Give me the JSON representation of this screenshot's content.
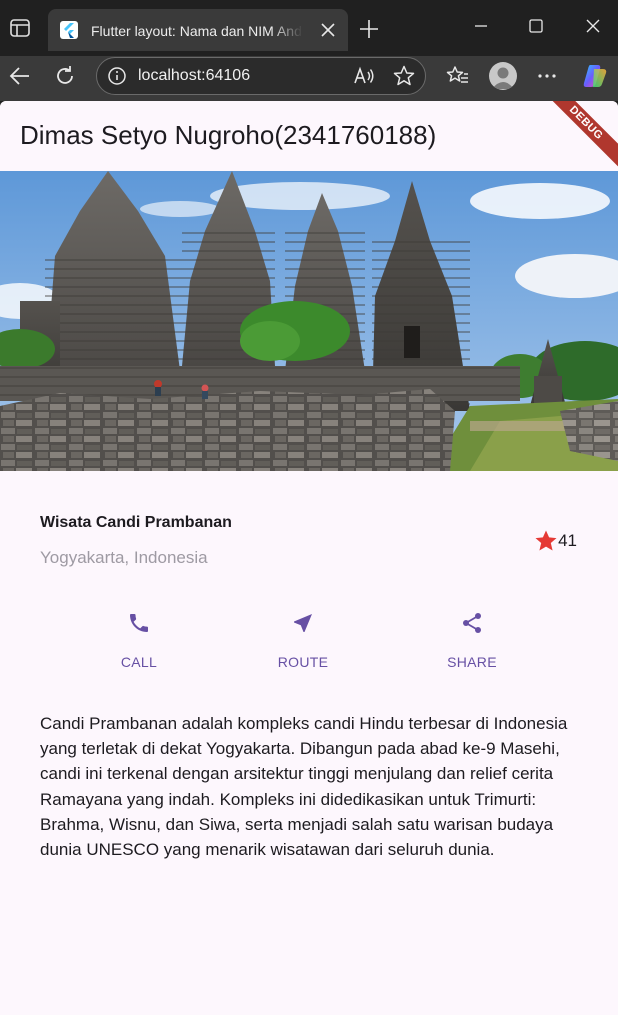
{
  "browser": {
    "tab_title": "Flutter layout: Nama dan NIM Anda",
    "url": "localhost:64106",
    "icons": [
      "window-menu-icon",
      "flutter-favicon",
      "tab-close-icon",
      "new-tab-icon",
      "minimize-icon",
      "maximize-icon",
      "window-close-icon",
      "back-icon",
      "refresh-icon",
      "site-info-icon",
      "read-aloud-icon",
      "favorite-star-icon",
      "favorites-icon",
      "profile-avatar",
      "more-icon",
      "copilot-icon"
    ]
  },
  "app": {
    "appbar_title": "Dimas Setyo Nugroho(2341760188)",
    "debug_label": "DEBUG",
    "place": {
      "name": "Wisata Candi Prambanan",
      "location": "Yogyakarta, Indonesia",
      "rating_count": "41"
    },
    "buttons": [
      {
        "label": "CALL",
        "icon": "phone-icon"
      },
      {
        "label": "ROUTE",
        "icon": "near-me-icon"
      },
      {
        "label": "SHARE",
        "icon": "share-icon"
      }
    ],
    "description": "Candi Prambanan adalah kompleks candi Hindu terbesar di Indonesia yang terletak di dekat Yogyakarta. Dibangun pada abad ke-9 Masehi, candi ini terkenal dengan arsitektur tinggi menjulang dan relief cerita Ramayana yang indah. Kompleks ini didedikasikan untuk Trimurti: Brahma, Wisnu, dan Siwa, serta menjadi salah satu warisan budaya dunia UNESCO yang menarik wisatawan dari seluruh dunia."
  },
  "colors": {
    "primary": "#6750a4",
    "star": "#e53935",
    "surface": "#fdf7fd",
    "debug_banner": "#b0372e"
  }
}
